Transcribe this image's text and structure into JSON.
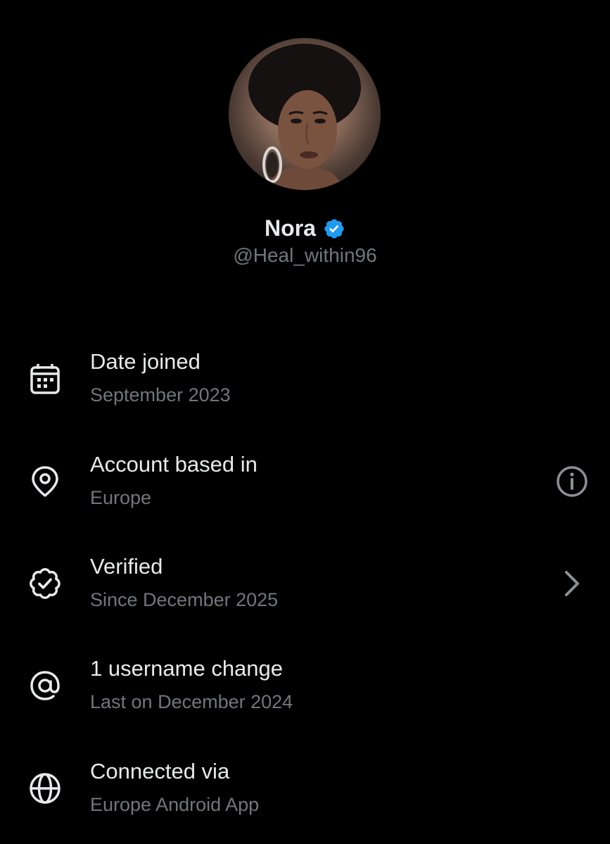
{
  "profile": {
    "display_name": "Nora",
    "handle": "@Heal_within96",
    "verified_color": "#1d9bf0"
  },
  "details": [
    {
      "icon": "calendar-icon",
      "title": "Date joined",
      "subtitle": "September 2023",
      "action": null
    },
    {
      "icon": "location-pin-icon",
      "title": "Account based in",
      "subtitle": "Europe",
      "action": "info-icon"
    },
    {
      "icon": "verified-badge-outline-icon",
      "title": "Verified",
      "subtitle": "Since December 2025",
      "action": "chevron-right-icon"
    },
    {
      "icon": "at-sign-icon",
      "title": "1 username change",
      "subtitle": "Last on December 2024",
      "action": null
    },
    {
      "icon": "globe-icon",
      "title": "Connected via",
      "subtitle": "Europe Android App",
      "action": null
    }
  ],
  "colors": {
    "background": "#000000",
    "primary_text": "#e7e9ea",
    "secondary_text": "#71767b"
  }
}
